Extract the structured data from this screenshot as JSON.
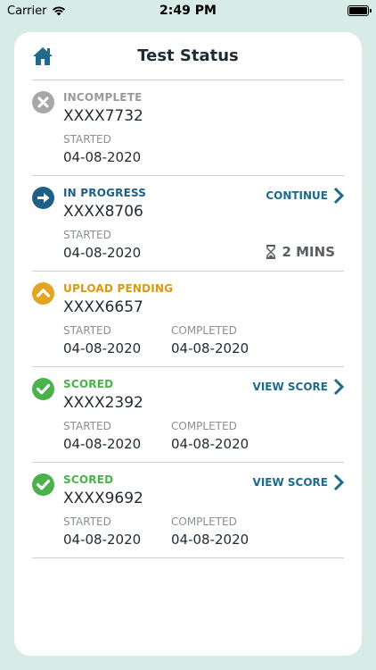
{
  "status_bar": {
    "carrier": "Carrier",
    "time": "2:49 PM"
  },
  "header": {
    "title": "Test Status"
  },
  "colors": {
    "incomplete": "#a7a7a7",
    "in_progress": "#1f5f86",
    "upload_pending": "#e3a41f",
    "scored": "#4bb14a",
    "action": "#1f6a8a"
  },
  "tests": [
    {
      "status": "INCOMPLETE",
      "id": "XXXX7732",
      "started_label": "STARTED",
      "started": "04-08-2020"
    },
    {
      "status": "IN PROGRESS",
      "id": "XXXX8706",
      "started_label": "STARTED",
      "started": "04-08-2020",
      "action": "CONTINUE",
      "timer": "2 MINS"
    },
    {
      "status": "UPLOAD PENDING",
      "id": "XXXX6657",
      "started_label": "STARTED",
      "started": "04-08-2020",
      "completed_label": "COMPLETED",
      "completed": "04-08-2020"
    },
    {
      "status": "SCORED",
      "id": "XXXX2392",
      "started_label": "STARTED",
      "started": "04-08-2020",
      "completed_label": "COMPLETED",
      "completed": "04-08-2020",
      "action": "VIEW SCORE"
    },
    {
      "status": "SCORED",
      "id": "XXXX9692",
      "started_label": "STARTED",
      "started": "04-08-2020",
      "completed_label": "COMPLETED",
      "completed": "04-08-2020",
      "action": "VIEW SCORE"
    }
  ]
}
